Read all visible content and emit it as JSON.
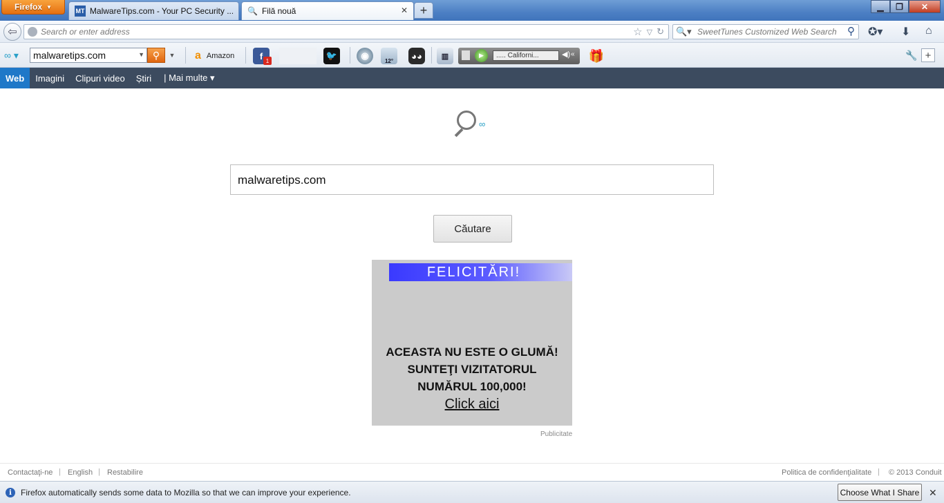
{
  "browser": {
    "menu_label": "Firefox",
    "tabs": [
      {
        "favicon": "MT",
        "title": "MalwareTips.com - Your PC Security ...",
        "active": false
      },
      {
        "favicon": "search-icon",
        "title": "Filă nouă",
        "active": true
      }
    ],
    "address_placeholder": "Search or enter address",
    "search_placeholder": "SweetTunes Customized Web Search"
  },
  "toolbar": {
    "search_value": "malwaretips.com",
    "amazon_label": "Amazon",
    "facebook_badge": "1",
    "weather_temp": "12°",
    "radio_station": "..... Californi..."
  },
  "categories": [
    "Web",
    "Imagini",
    "Clipuri video",
    "Știri",
    "| Mai multe ▾"
  ],
  "main": {
    "search_value": "malwaretips.com",
    "search_button": "Căutare"
  },
  "ad": {
    "banner": "FELICITĂRI!",
    "line1": "ACEASTA NU ESTE O GLUMĂ!",
    "line2": "SUNTEŢI VIZITATORUL",
    "line3": "NUMĂRUL 100,000!",
    "link": "Click aici",
    "label": "Publicitate"
  },
  "footer": {
    "contact": "Contactaţi-ne",
    "english": "English",
    "reset": "Restabilire",
    "privacy": "Politica de confidenţialitate",
    "copyright": "© 2013 Conduit"
  },
  "notification": {
    "message": "Firefox automatically sends some data to Mozilla so that we can improve your experience.",
    "button": "Choose What I Share"
  },
  "colors": {
    "firefox_orange": "#e56f10",
    "category_bar": "#3c4b5f",
    "category_active": "#1f78c8",
    "ad_banner": "#3a3aff"
  }
}
